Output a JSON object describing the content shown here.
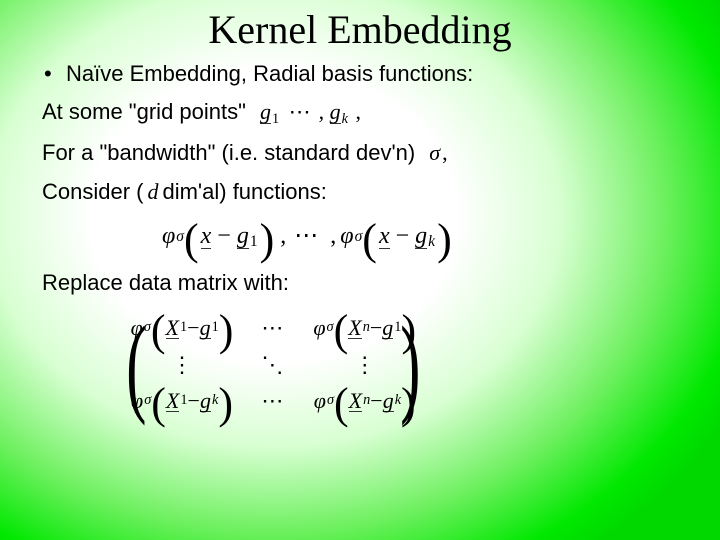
{
  "title": "Kernel Embedding",
  "line1": "Naïve Embedding, Radial basis functions:",
  "line2a": "At some \"grid points\"",
  "g1": "g",
  "g1sub": "1",
  "dots": "⋯",
  "gk": "g",
  "gksub": "k",
  "comma": ",",
  "line3a": "For a \"bandwidth\" (i.e. standard dev'n)",
  "sigma": "σ",
  "line4a": "Consider  (",
  "d": "d",
  "line4b": "  dim'al)  functions:",
  "phi": "φ",
  "x": "x",
  "minus": " − ",
  "line5": "Replace data matrix with:",
  "X": "X",
  "sub1": "1",
  "subn": "n",
  "subk": "k",
  "vdots": "⋮",
  "ddots": "⋱",
  "hdots": "⋯"
}
